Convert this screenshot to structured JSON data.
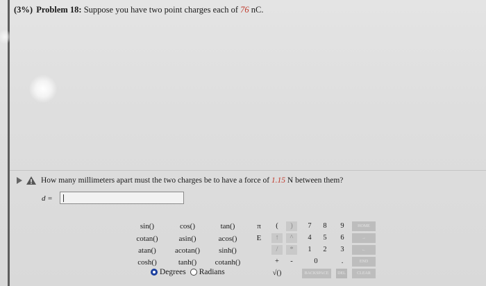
{
  "problem": {
    "points": "(3%)",
    "label": "Problem 18:",
    "text_before": "Suppose you have two point charges each of",
    "charge_value": "76",
    "text_after": "nC."
  },
  "question": {
    "text_before": "How many millimeters apart must the two charges be to have a force of",
    "force_value": "1.15",
    "text_after": "N between them?"
  },
  "answer": {
    "label": "d =",
    "value": ""
  },
  "functions": {
    "row1": [
      "sin()",
      "cos()",
      "tan()"
    ],
    "row2": [
      "cotan()",
      "asin()",
      "acos()"
    ],
    "row3": [
      "atan()",
      "acotan()",
      "sinh()"
    ],
    "row4": [
      "cosh()",
      "tanh()",
      "cotanh()"
    ]
  },
  "angle_mode": {
    "degrees": "Degrees",
    "radians": "Radians",
    "selected": "Degrees"
  },
  "symbols": {
    "pi": "π",
    "e": "E"
  },
  "keypad": {
    "open_paren": "(",
    "close_paren": ")",
    "up_arrow": "↑",
    "up_caret": "^",
    "divide": "/",
    "multiply": "*",
    "plus": "+",
    "minus": "-",
    "sqrt": "√()",
    "digits_row1": [
      "7",
      "8",
      "9"
    ],
    "digits_row2": [
      "4",
      "5",
      "6"
    ],
    "digits_row3": [
      "1",
      "2",
      "3"
    ],
    "zero": "0",
    "dot": ".",
    "backspace": "BACKSPACE",
    "del": "DEL",
    "home": "HOME",
    "end": "END",
    "clear": "CLEAR",
    "left_arrow": "←",
    "right_arrow": "→"
  }
}
